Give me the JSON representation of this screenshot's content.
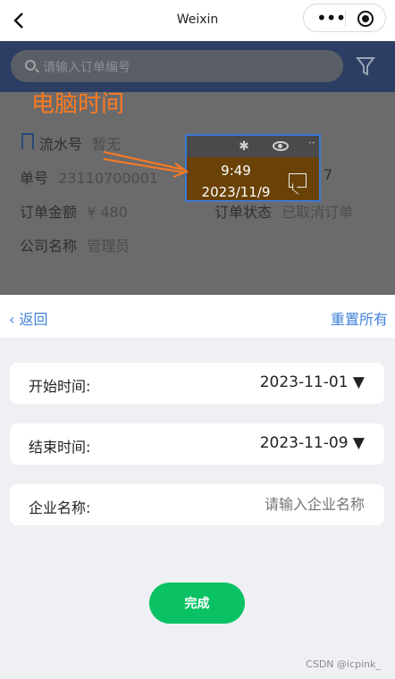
{
  "topbar": {
    "title": "Weixin",
    "capsule_dots": "•••"
  },
  "underlay": {
    "search_placeholder": "请输入订单编号",
    "annotation_label": "电脑时间",
    "serial_label": "流水号",
    "serial_value": "暂无",
    "order_no_label": "单号",
    "order_no_value": "23110700001",
    "order_no_right_suffix": "7",
    "amount_label": "订单金额",
    "amount_value": "¥ 480",
    "status_label": "订单状态",
    "status_value": "已取消订单",
    "company_label": "公司名称",
    "company_value": "管理员",
    "popup": {
      "time": "9:49",
      "date": "2023/11/9",
      "more": "··"
    }
  },
  "panel": {
    "back_label": "返回",
    "reset_label": "重置所有",
    "start_label": "开始时间:",
    "start_value": "2023-11-01 ▼",
    "end_label": "结束时间:",
    "end_value": "2023-11-09 ▼",
    "company_label": "企业名称:",
    "company_placeholder": "请输入企业名称",
    "done_label": "完成"
  },
  "watermark": "CSDN @icpink_",
  "colors": {
    "accent_blue": "#3f82d8",
    "done_green": "#0ac264",
    "annotation_orange": "#ff7a22",
    "nav_dark": "#2c3e63"
  }
}
